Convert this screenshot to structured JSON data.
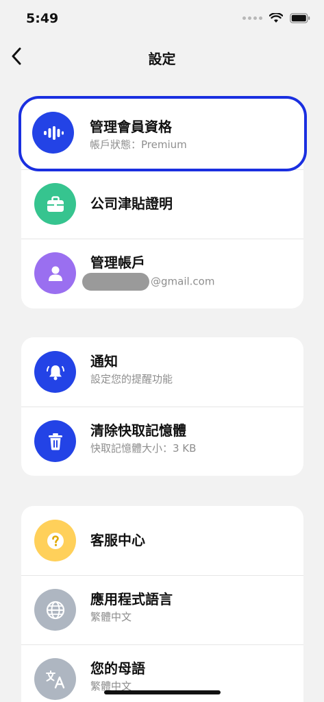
{
  "status_bar": {
    "time": "5:49"
  },
  "nav": {
    "title": "設定"
  },
  "colors": {
    "blue": "#2343e6",
    "green": "#36c48f",
    "purple": "#9a6ff0",
    "yellow": "#ffd05a",
    "gray": "#aeb6c1",
    "highlight": "#1a2fe0"
  },
  "group1": [
    {
      "icon": "audio-wave-icon",
      "title": "管理會員資格",
      "subtitle": "帳戶狀態：Premium"
    },
    {
      "icon": "briefcase-icon",
      "title": "公司津貼證明"
    },
    {
      "icon": "person-icon",
      "title": "管理帳戶",
      "subtitle": "@gmail.com"
    }
  ],
  "group2": [
    {
      "icon": "bell-icon",
      "title": "通知",
      "subtitle": "設定您的提醒功能"
    },
    {
      "icon": "trash-icon",
      "title": "清除快取記憶體",
      "subtitle": "快取記憶體大小：3 KB"
    }
  ],
  "group3": [
    {
      "icon": "question-icon",
      "title": "客服中心"
    },
    {
      "icon": "globe-icon",
      "title": "應用程式語言",
      "subtitle": "繁體中文"
    },
    {
      "icon": "translate-icon",
      "title": "您的母語",
      "subtitle": "繁體中文"
    }
  ]
}
